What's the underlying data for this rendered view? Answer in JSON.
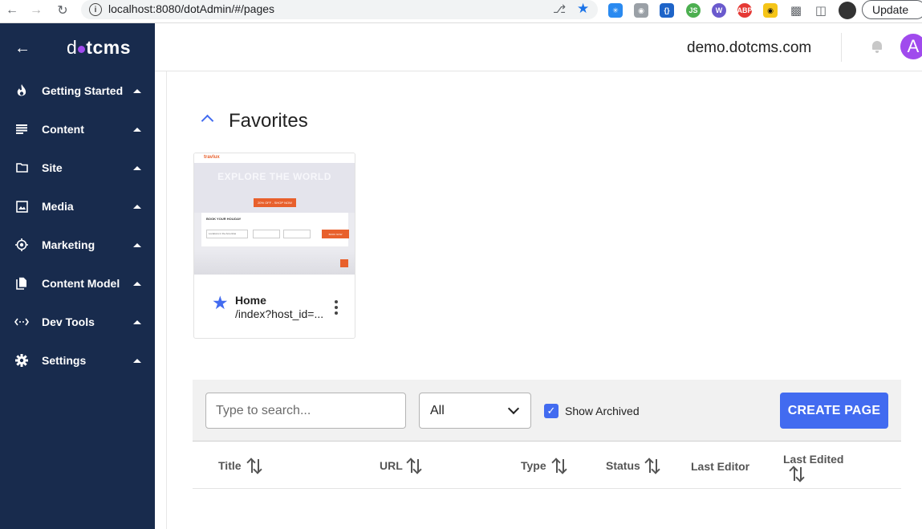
{
  "browser": {
    "url": "localhost:8080/dotAdmin/#/pages",
    "update_label": "Update",
    "extensions": [
      {
        "name": "asterisk-extension-icon",
        "color": "#2a8af0"
      },
      {
        "name": "camera-extension-icon",
        "color": "#5f6368"
      },
      {
        "name": "css-extension-icon",
        "color": "#1e64c8"
      },
      {
        "name": "js-extension-icon",
        "color": "#4caf50"
      },
      {
        "name": "wappalyzer-extension-icon",
        "color": "#6a5acd"
      },
      {
        "name": "adblock-extension-icon",
        "color": "#e53935",
        "label": "ABP"
      },
      {
        "name": "extension-icon-8",
        "color": "#f5c518"
      }
    ]
  },
  "sidebar": {
    "logo_prefix": "d",
    "logo_suffix": "tcms",
    "items": [
      {
        "label": "Getting Started",
        "icon": "flame-icon"
      },
      {
        "label": "Content",
        "icon": "list-icon"
      },
      {
        "label": "Site",
        "icon": "folder-icon"
      },
      {
        "label": "Media",
        "icon": "image-icon"
      },
      {
        "label": "Marketing",
        "icon": "target-icon"
      },
      {
        "label": "Content Model",
        "icon": "file-copy-icon"
      },
      {
        "label": "Dev Tools",
        "icon": "code-icon"
      },
      {
        "label": "Settings",
        "icon": "gear-icon"
      }
    ]
  },
  "header": {
    "site": "demo.dotcms.com",
    "avatar_letter": "A"
  },
  "favorites": {
    "title": "Favorites",
    "card": {
      "title": "Home",
      "url": "/index?host_id=...",
      "thumb_logo": "travlux",
      "thumb_headline": "EXPLORE THE WORLD",
      "thumb_button": "20% OFF - SHOP NOW",
      "thumb_form_title": "BOOK YOUR HOLIDAY",
      "thumb_field_1": "Locations in the Americas",
      "thumb_search": "BOOK NOW"
    }
  },
  "toolbar": {
    "search_placeholder": "Type to search...",
    "filter_value": "All",
    "show_archived_label": "Show Archived",
    "show_archived_checked": true,
    "create_label": "CREATE PAGE"
  },
  "table": {
    "columns": [
      "Title",
      "URL",
      "Type",
      "Status",
      "Last Editor",
      "Last Edited"
    ]
  }
}
